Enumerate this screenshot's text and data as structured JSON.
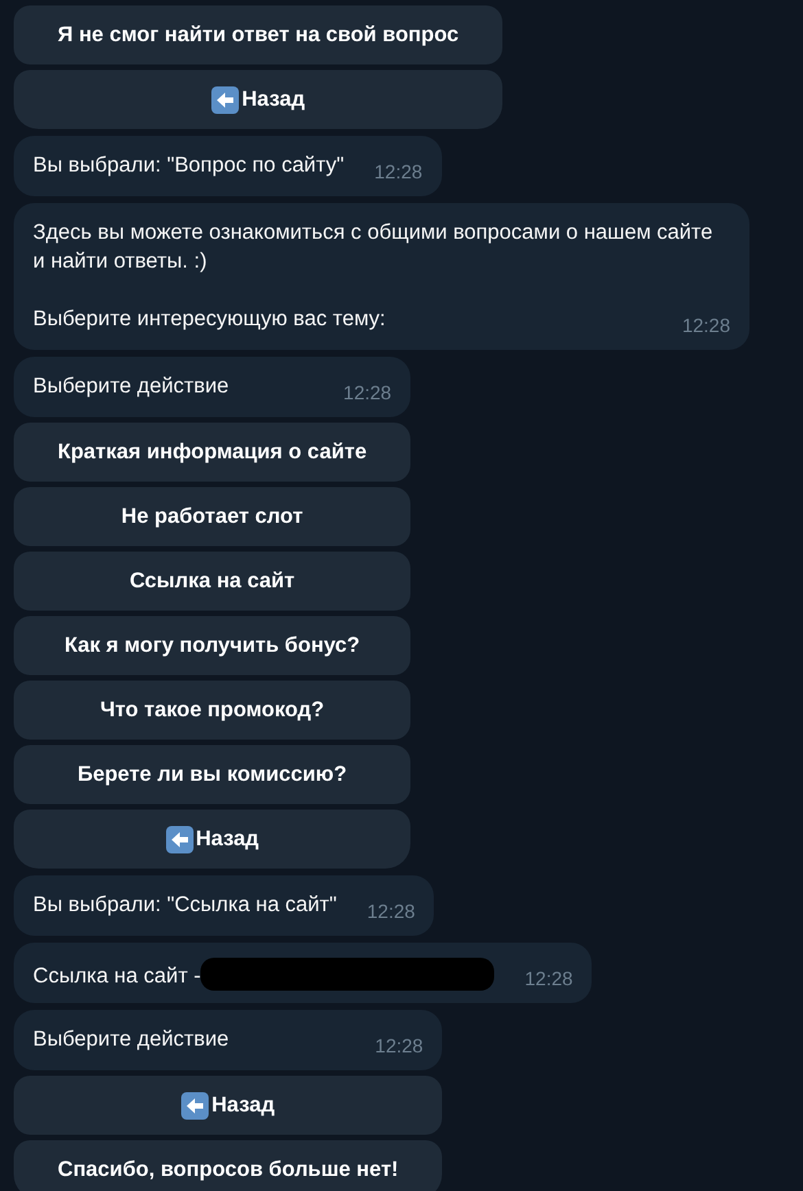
{
  "chat": [
    {
      "kind": "keyboard",
      "buttons": [
        {
          "label": "Я не смог найти ответ на свой вопрос",
          "kind": "text"
        },
        {
          "label": "Назад",
          "kind": "back"
        }
      ]
    },
    {
      "kind": "bubble",
      "paragraphs": [
        "Вы выбрали: \"Вопрос по сайту\""
      ],
      "time": "12:28"
    },
    {
      "kind": "bubble",
      "paragraphs": [
        "Здесь вы можете ознакомиться с общими вопросами о нашем сайте и найти ответы. :)",
        "Выберите интересующую вас тему:"
      ],
      "time": "12:28"
    },
    {
      "kind": "bubble",
      "paragraphs": [
        "Выберите действие"
      ],
      "time": "12:28",
      "buttons": [
        {
          "label": "Краткая информация о сайте",
          "kind": "text"
        },
        {
          "label": "Не работает слот",
          "kind": "text"
        },
        {
          "label": "Ссылка на сайт",
          "kind": "text"
        },
        {
          "label": "Как я могу получить бонус?",
          "kind": "text"
        },
        {
          "label": "Что такое промокод?",
          "kind": "text"
        },
        {
          "label": "Берете ли вы комиссию?",
          "kind": "text"
        },
        {
          "label": "Назад",
          "kind": "back"
        }
      ]
    },
    {
      "kind": "bubble",
      "paragraphs": [
        "Вы выбрали: \"Ссылка на сайт\""
      ],
      "time": "12:28"
    },
    {
      "kind": "bubble",
      "paragraphs": [
        "Ссылка на сайт -"
      ],
      "redacted": true,
      "time": "12:28"
    },
    {
      "kind": "bubble",
      "paragraphs": [
        "Выберите действие"
      ],
      "time": "12:28",
      "buttons": [
        {
          "label": "Назад",
          "kind": "back"
        },
        {
          "label": "Спасибо, вопросов больше нет!",
          "kind": "text"
        }
      ]
    }
  ]
}
